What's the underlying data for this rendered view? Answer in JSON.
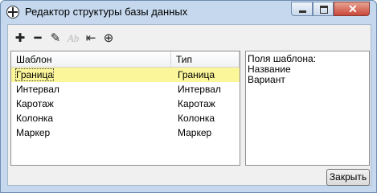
{
  "window": {
    "title": "Редактор структуры базы данных"
  },
  "toolbar": {
    "add": "✚",
    "remove": "━",
    "edit": "✎",
    "rename": "Ab",
    "back": "⇤",
    "link": "⊕"
  },
  "table": {
    "columns": [
      "Шаблон",
      "Тип"
    ],
    "rows": [
      [
        "Граница",
        "Граница"
      ],
      [
        "Интервал",
        "Интервал"
      ],
      [
        "Каротаж",
        "Каротаж"
      ],
      [
        "Колонка",
        "Колонка"
      ],
      [
        "Маркер",
        "Маркер"
      ]
    ],
    "selected_index": 0
  },
  "fields_panel": {
    "lines": [
      "Поля шаблона:",
      "Название",
      "Вариант"
    ]
  },
  "buttons": {
    "close": "Закрыть"
  }
}
